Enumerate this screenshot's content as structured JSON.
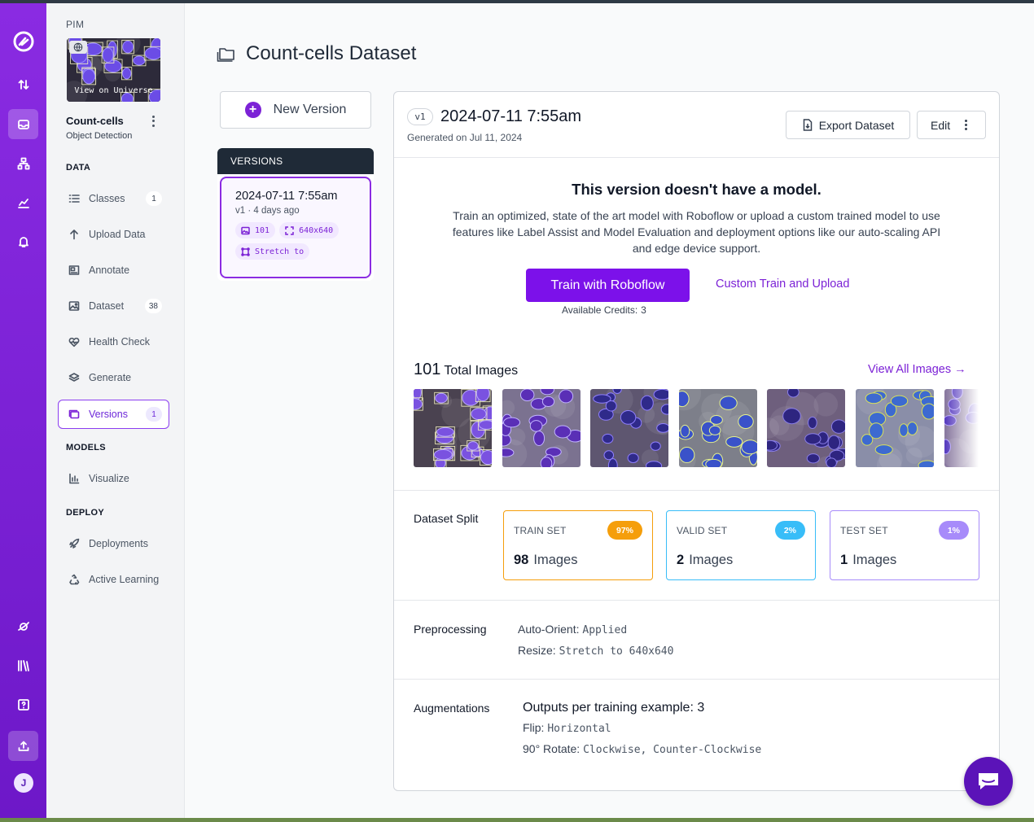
{
  "workspace": {
    "label": "PIM"
  },
  "project": {
    "thumbnail_caption": "View on Universe",
    "name": "Count-cells",
    "type": "Object Detection"
  },
  "sidebar": {
    "sections": {
      "data": "DATA",
      "models": "MODELS",
      "deploy": "DEPLOY"
    },
    "items": [
      {
        "label": "Classes",
        "count": "1",
        "icon": "list-icon"
      },
      {
        "label": "Upload Data",
        "count": "",
        "icon": "upload-arrow-icon"
      },
      {
        "label": "Annotate",
        "count": "",
        "icon": "annotate-icon"
      },
      {
        "label": "Dataset",
        "count": "38",
        "icon": "image-icon"
      },
      {
        "label": "Health Check",
        "count": "",
        "icon": "heartbeat-icon"
      },
      {
        "label": "Generate",
        "count": "",
        "icon": "layers-icon"
      },
      {
        "label": "Versions",
        "count": "1",
        "icon": "versions-icon",
        "active": true
      },
      {
        "label": "Visualize",
        "count": "",
        "icon": "chart-icon"
      },
      {
        "label": "Deployments",
        "count": "",
        "icon": "rocket-icon"
      },
      {
        "label": "Active Learning",
        "count": "",
        "icon": "recycle-icon"
      }
    ]
  },
  "page": {
    "title": "Count-cells Dataset"
  },
  "new_version_label": "New Version",
  "versions_panel": {
    "heading": "VERSIONS",
    "selected": {
      "title": "2024-07-11 7:55am",
      "subtitle": "v1 · 4 days ago",
      "chip_images": "101",
      "chip_size": "640x640",
      "chip_resize": "Stretch to"
    }
  },
  "version": {
    "badge": "v1",
    "title": "2024-07-11 7:55am",
    "generated": "Generated on Jul 11, 2024",
    "export_label": "Export Dataset",
    "edit_label": "Edit"
  },
  "model": {
    "title": "This version doesn't have a model.",
    "description": "Train an optimized, state of the art model with Roboflow or upload a custom trained model to use features like Label Assist and Model Evaluation and deployment options like our auto-scaling API and edge device support.",
    "train_label": "Train with Roboflow",
    "custom_label": "Custom Train and Upload",
    "credits_label": "Available Credits:",
    "credits_value": "3"
  },
  "images": {
    "total": "101",
    "total_label": "Total Images",
    "view_all": "View All Images →"
  },
  "split": {
    "label": "Dataset Split",
    "train": {
      "name": "TRAIN SET",
      "pct": "97%",
      "count": "98",
      "unit": "Images",
      "color": "#f59e0b"
    },
    "valid": {
      "name": "VALID SET",
      "pct": "2%",
      "count": "2",
      "unit": "Images",
      "color": "#38bdf8"
    },
    "test": {
      "name": "TEST SET",
      "pct": "1%",
      "count": "1",
      "unit": "Images",
      "color": "#a78bfa"
    }
  },
  "preprocessing": {
    "label": "Preprocessing",
    "auto_orient_key": "Auto-Orient:",
    "auto_orient_val": "Applied",
    "resize_key": "Resize:",
    "resize_val": "Stretch to 640x640"
  },
  "augmentations": {
    "label": "Augmentations",
    "outputs": "Outputs per training example: 3",
    "flip_key": "Flip:",
    "flip_val": "Horizontal",
    "rotate_key": "90° Rotate:",
    "rotate_val": "Clockwise, Counter-Clockwise"
  }
}
